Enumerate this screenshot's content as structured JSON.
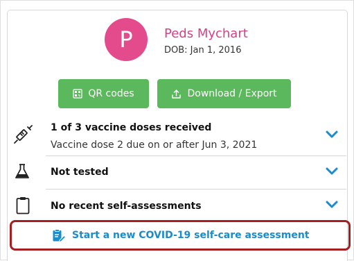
{
  "patient": {
    "initial": "P",
    "name": "Peds Mychart",
    "dob": "DOB: Jan 1, 2016"
  },
  "buttons": {
    "qr_label": "QR codes",
    "download_label": "Download / Export"
  },
  "rows": [
    {
      "icon": "syringe-icon",
      "title": "1 of 3 vaccine doses received",
      "subtitle": "Vaccine dose 2 due on or after Jun 3, 2021"
    },
    {
      "icon": "flask-icon",
      "title": "Not tested",
      "subtitle": ""
    },
    {
      "icon": "clipboard-icon",
      "title": "No recent self-assessments",
      "subtitle": ""
    }
  ],
  "assessment_link": {
    "icon": "clipboard-edit-icon",
    "label": "Start a new COVID-19 self-care assessment"
  },
  "colors": {
    "avatar": "#e44b8d",
    "name": "#d63f87",
    "button": "#5cb85c",
    "chevron": "#1a8ccc",
    "link": "#1a8ccc",
    "highlight_border": "#a51e22"
  }
}
